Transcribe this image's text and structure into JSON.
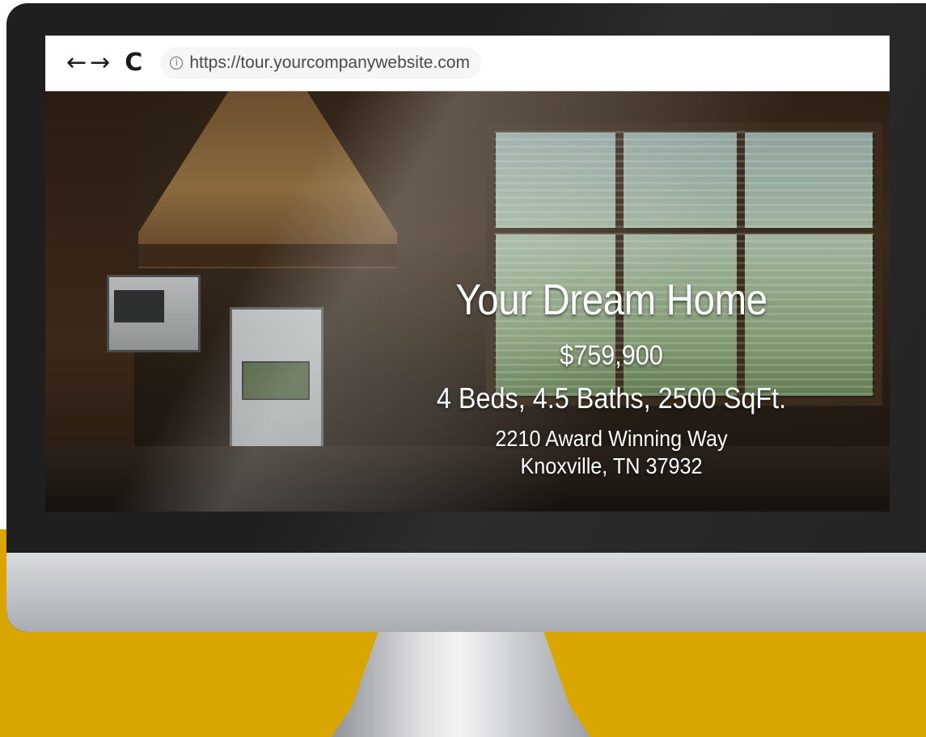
{
  "browser": {
    "back_icon": "←",
    "forward_icon": "→",
    "reload_icon": "C",
    "info_icon": "i",
    "url": "https://tour.yourcompanywebsite.com"
  },
  "listing": {
    "title": "Your Dream Home",
    "price": "$759,900",
    "specs": "4 Beds, 4.5 Baths, 2500 SqFt.",
    "street": "2210 Award Winning Way",
    "city": "Knoxville, TN 37932"
  },
  "colors": {
    "accent_band": "#d9a600",
    "bezel": "#1f1f20",
    "chin": "#c3c6ca"
  }
}
